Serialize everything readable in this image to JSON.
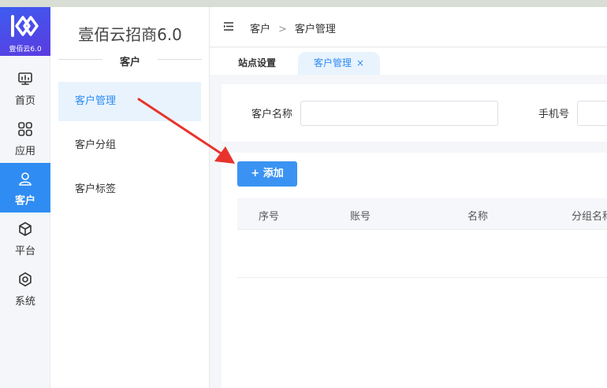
{
  "brand": {
    "logo_text": "壹佰云6.0",
    "app_title": "壹佰云招商6.0"
  },
  "rail": {
    "items": [
      {
        "label": "首页",
        "icon": "monitor-icon"
      },
      {
        "label": "应用",
        "icon": "apps-grid-icon"
      },
      {
        "label": "客户",
        "icon": "user-icon",
        "active": true
      },
      {
        "label": "平台",
        "icon": "cube-icon"
      },
      {
        "label": "系统",
        "icon": "gear-icon"
      }
    ]
  },
  "submenu": {
    "section": "客户",
    "items": [
      {
        "label": "客户管理",
        "active": true
      },
      {
        "label": "客户分组"
      },
      {
        "label": "客户标签"
      }
    ]
  },
  "header": {
    "breadcrumb": [
      "客户",
      "客户管理"
    ],
    "separator": ">"
  },
  "tabs": [
    {
      "label": "站点设置"
    },
    {
      "label": "客户管理",
      "active": true,
      "close": "×"
    }
  ],
  "search": {
    "name_label": "客户名称",
    "name_value": "",
    "phone_label": "手机号",
    "phone_value": ""
  },
  "toolbar": {
    "add_label": "+ 添加"
  },
  "table": {
    "columns": [
      "序号",
      "账号",
      "名称",
      "分组名称"
    ],
    "rows": []
  },
  "colors": {
    "accent": "#2f8cf2",
    "annotation_arrow": "#e8332c"
  }
}
